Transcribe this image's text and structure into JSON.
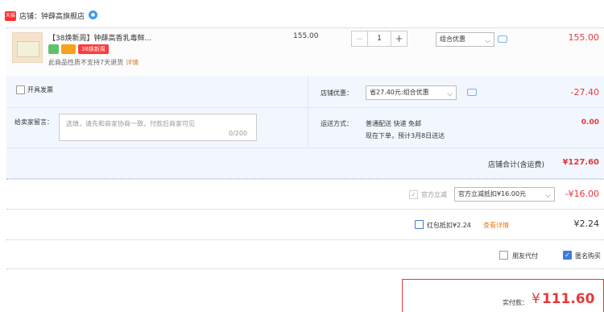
{
  "shop": {
    "tag": "天猫",
    "label": "店铺：钟薛高旗舰店",
    "chat_icon": "chat-bubble-icon"
  },
  "item": {
    "title": "【38焕新周】钟薛高香乳毒鲜...",
    "badge_text": "38焕新周",
    "note": "此商品性质不支持7天退货",
    "note_detail": "详情",
    "unit_price": "155.00",
    "quantity": "1",
    "promo_select": "组合优惠",
    "total": "155.00"
  },
  "invoice": {
    "label": "开具发票"
  },
  "shop_discount": {
    "label": "店铺优惠：",
    "select": "省27.40元:组合优惠",
    "amount": "-27.40"
  },
  "message": {
    "label": "给卖家留言：",
    "placeholder": "选填，请先和商家协商一致，付款后商家可见",
    "count": "0/200"
  },
  "shipping": {
    "label": "运送方式：",
    "line1": "普通配送 快递 免邮",
    "line2": "现在下单，预计3月8日送达",
    "amount": "0.00"
  },
  "shop_total": {
    "label": "店铺合计(含运费)",
    "amount": "¥127.60"
  },
  "official": {
    "label": "官方立减",
    "select": "官方立减抵扣¥16.00元",
    "amount": "-¥16.00"
  },
  "redpacket": {
    "label": "红包抵扣¥2.24",
    "detail": "查看详情",
    "amount": "¥2.24"
  },
  "options": {
    "friend_pay": "朋友代付",
    "anonymous": "匿名购买"
  },
  "payment": {
    "label": "实付款：",
    "currency": "¥",
    "amount": "111.60"
  },
  "colors": {
    "price_red": "#e4393c",
    "accent_blue": "#3d7be0",
    "info_bg": "#f2f7ff"
  }
}
